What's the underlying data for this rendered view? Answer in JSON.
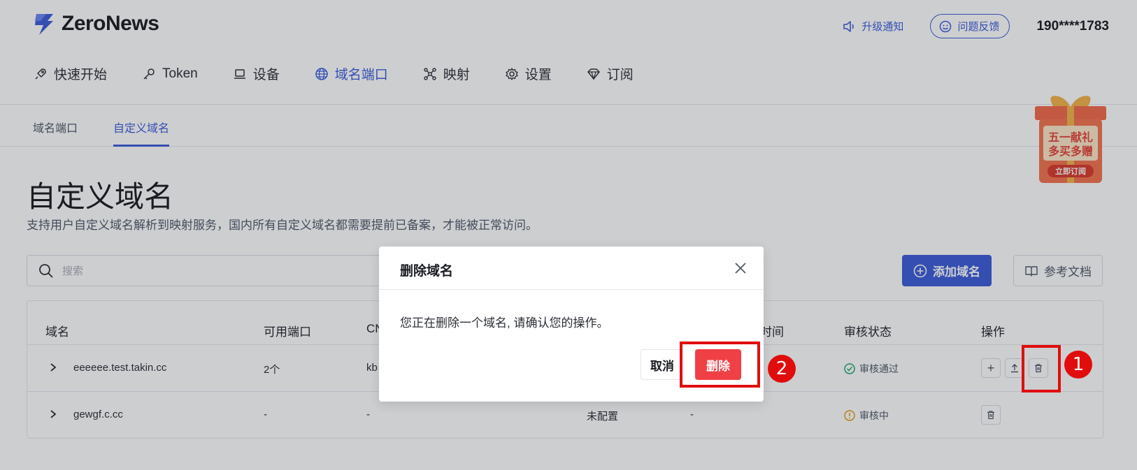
{
  "header": {
    "logo_text": "ZeroNews",
    "notify_label": "升级通知",
    "feedback_label": "问题反馈",
    "user_phone": "190****1783"
  },
  "nav": {
    "items": [
      {
        "label": "快速开始",
        "icon": "rocket-icon"
      },
      {
        "label": "Token",
        "icon": "key-icon"
      },
      {
        "label": "设备",
        "icon": "laptop-icon"
      },
      {
        "label": "域名端口",
        "icon": "globe-icon",
        "active": true
      },
      {
        "label": "映射",
        "icon": "network-icon"
      },
      {
        "label": "设置",
        "icon": "gear-icon"
      },
      {
        "label": "订阅",
        "icon": "diamond-icon"
      }
    ]
  },
  "subnav": {
    "items": [
      {
        "label": "域名端口"
      },
      {
        "label": "自定义域名",
        "active": true
      }
    ]
  },
  "page": {
    "title": "自定义域名",
    "description": "支持用户自定义域名解析到映射服务，国内所有自定义域名都需要提前已备案，才能被正常访问。",
    "search_placeholder": "搜索",
    "add_button": "添加域名",
    "docs_button": "参考文档"
  },
  "promo": {
    "line1": "五一献礼",
    "line2": "多买多赠",
    "cta": "立即订阅"
  },
  "table": {
    "headers": [
      "域名",
      "可用端口",
      "CN",
      "时间",
      "审核状态",
      "操作"
    ],
    "rows": [
      {
        "domain": "eeeeee.test.takin.cc",
        "ports": "2个",
        "cname": "kb",
        "ssl": "",
        "time": "",
        "status": "审核通过",
        "status_type": "approved"
      },
      {
        "domain": "gewgf.c.cc",
        "ports": "-",
        "cname": "-",
        "ssl": "未配置",
        "time": "-",
        "status": "审核中",
        "status_type": "pending"
      }
    ]
  },
  "modal": {
    "title": "删除域名",
    "body": "您正在删除一个域名, 请确认您的操作。",
    "cancel_label": "取消",
    "confirm_label": "删除"
  },
  "annotations": {
    "badge1": "1",
    "badge2": "2",
    "color": "#e10d0d"
  },
  "colors": {
    "accent": "#3c5bd9",
    "danger": "#ef4045",
    "success": "#22a86b",
    "warning": "#e59a17"
  }
}
